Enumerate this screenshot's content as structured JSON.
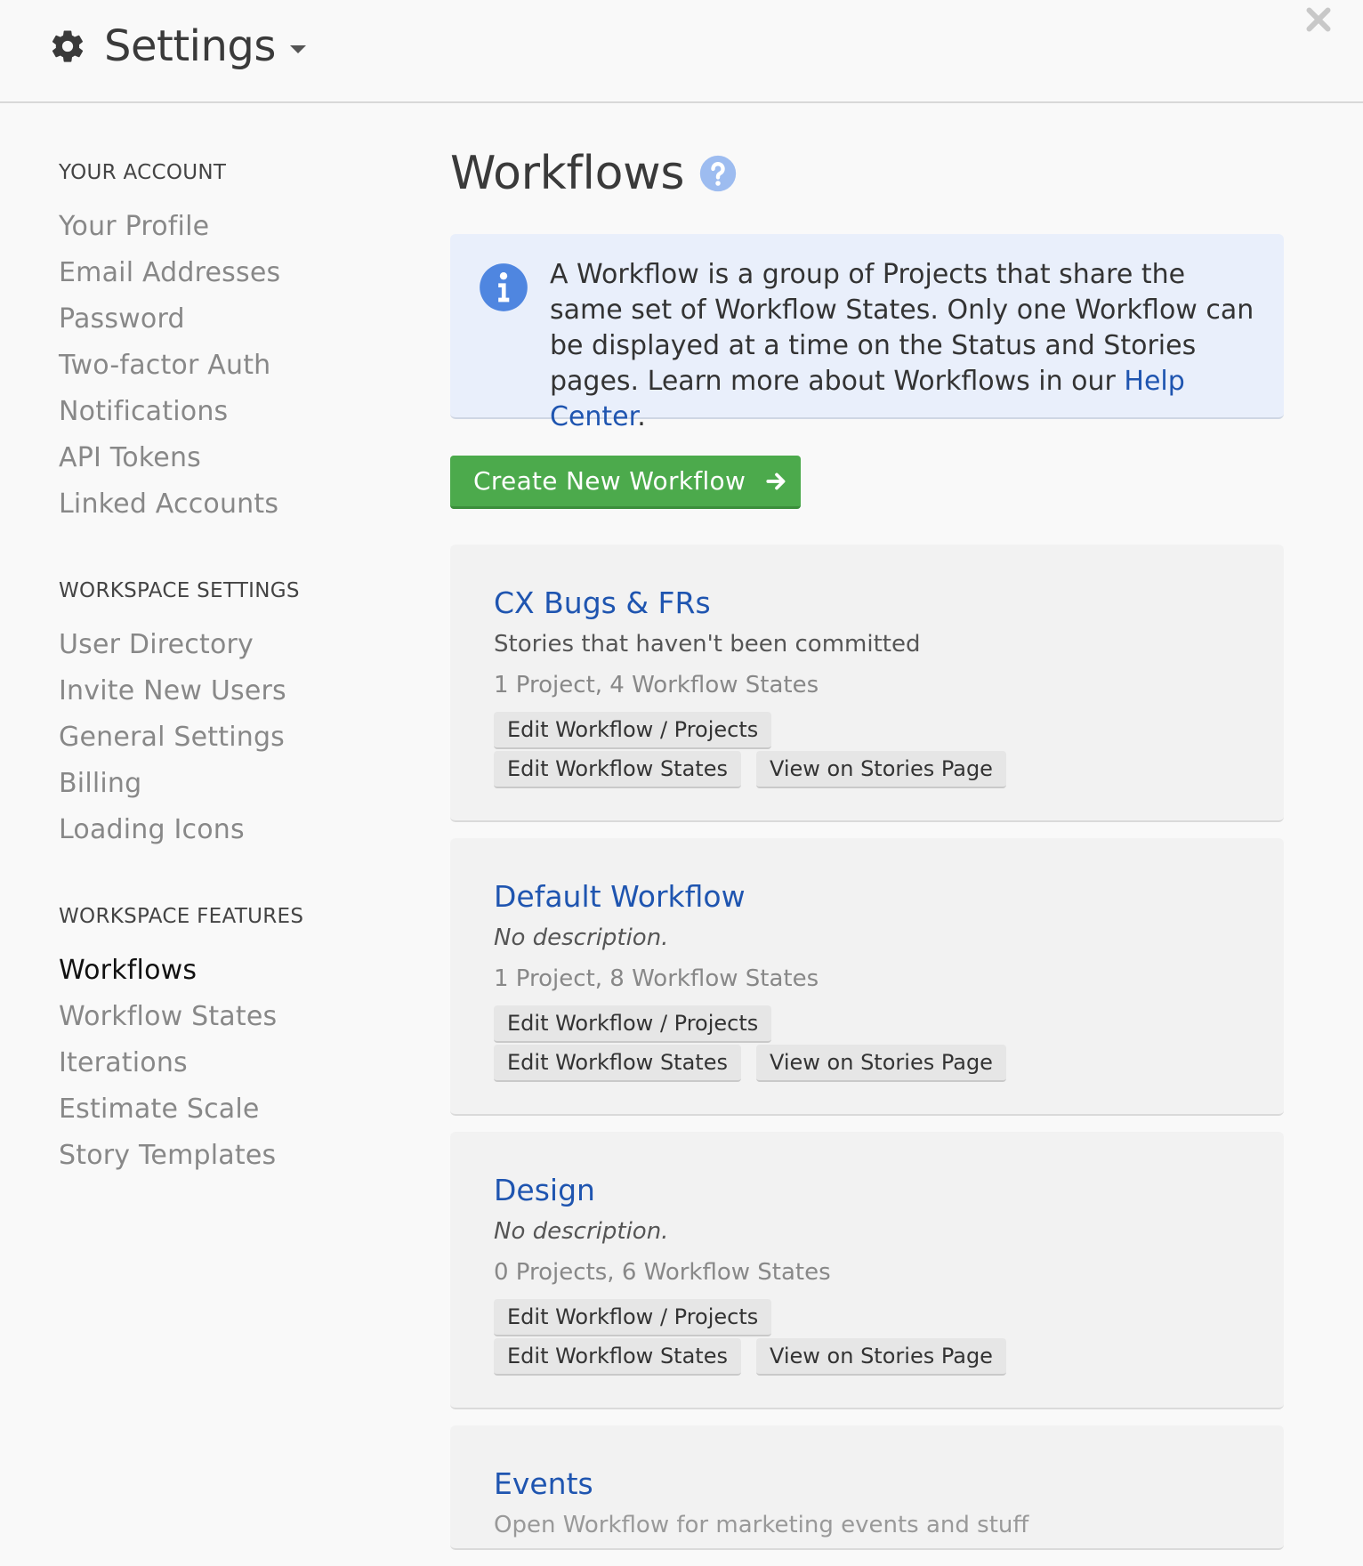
{
  "header": {
    "title": "Settings"
  },
  "sidebar": {
    "sections": [
      {
        "heading": "YOUR ACCOUNT",
        "items": [
          "Your Profile",
          "Email Addresses",
          "Password",
          "Two-factor Auth",
          "Notifications",
          "API Tokens",
          "Linked Accounts"
        ]
      },
      {
        "heading": "WORKSPACE SETTINGS",
        "items": [
          "User Directory",
          "Invite New Users",
          "General Settings",
          "Billing",
          "Loading Icons"
        ]
      },
      {
        "heading": "WORKSPACE FEATURES",
        "items": [
          "Workflows",
          "Workflow States",
          "Iterations",
          "Estimate Scale",
          "Story Templates"
        ]
      }
    ],
    "active_item": "Workflows"
  },
  "main": {
    "title": "Workflows",
    "info": {
      "text": "A Workflow is a group of Projects that share the same set of Workflow States. Only one Workflow can be displayed at a time on the Status and Stories pages. Learn more about Workflows in our ",
      "link": "Help Center",
      "suffix": "."
    },
    "create_button": "Create New Workflow",
    "card_buttons": {
      "edit_projects": "Edit Workflow / Projects",
      "edit_states": "Edit Workflow States",
      "view_stories": "View on Stories Page"
    },
    "workflows": [
      {
        "name": "CX Bugs & FRs",
        "description": "Stories that haven't been committed",
        "meta": "1 Project, 4 Workflow States"
      },
      {
        "name": "Default Workflow",
        "description": "No description.",
        "meta": "1 Project, 8 Workflow States"
      },
      {
        "name": "Design",
        "description": "No description.",
        "meta": "0 Projects, 6 Workflow States"
      },
      {
        "name": "Events",
        "description": "Open Workflow for marketing events and stuff",
        "meta": ""
      }
    ]
  },
  "colors": {
    "accent_green": "#4caa4c",
    "link_blue": "#1f55b0",
    "info_bg": "#e9effb",
    "icon_blue": "#4f86e0"
  }
}
